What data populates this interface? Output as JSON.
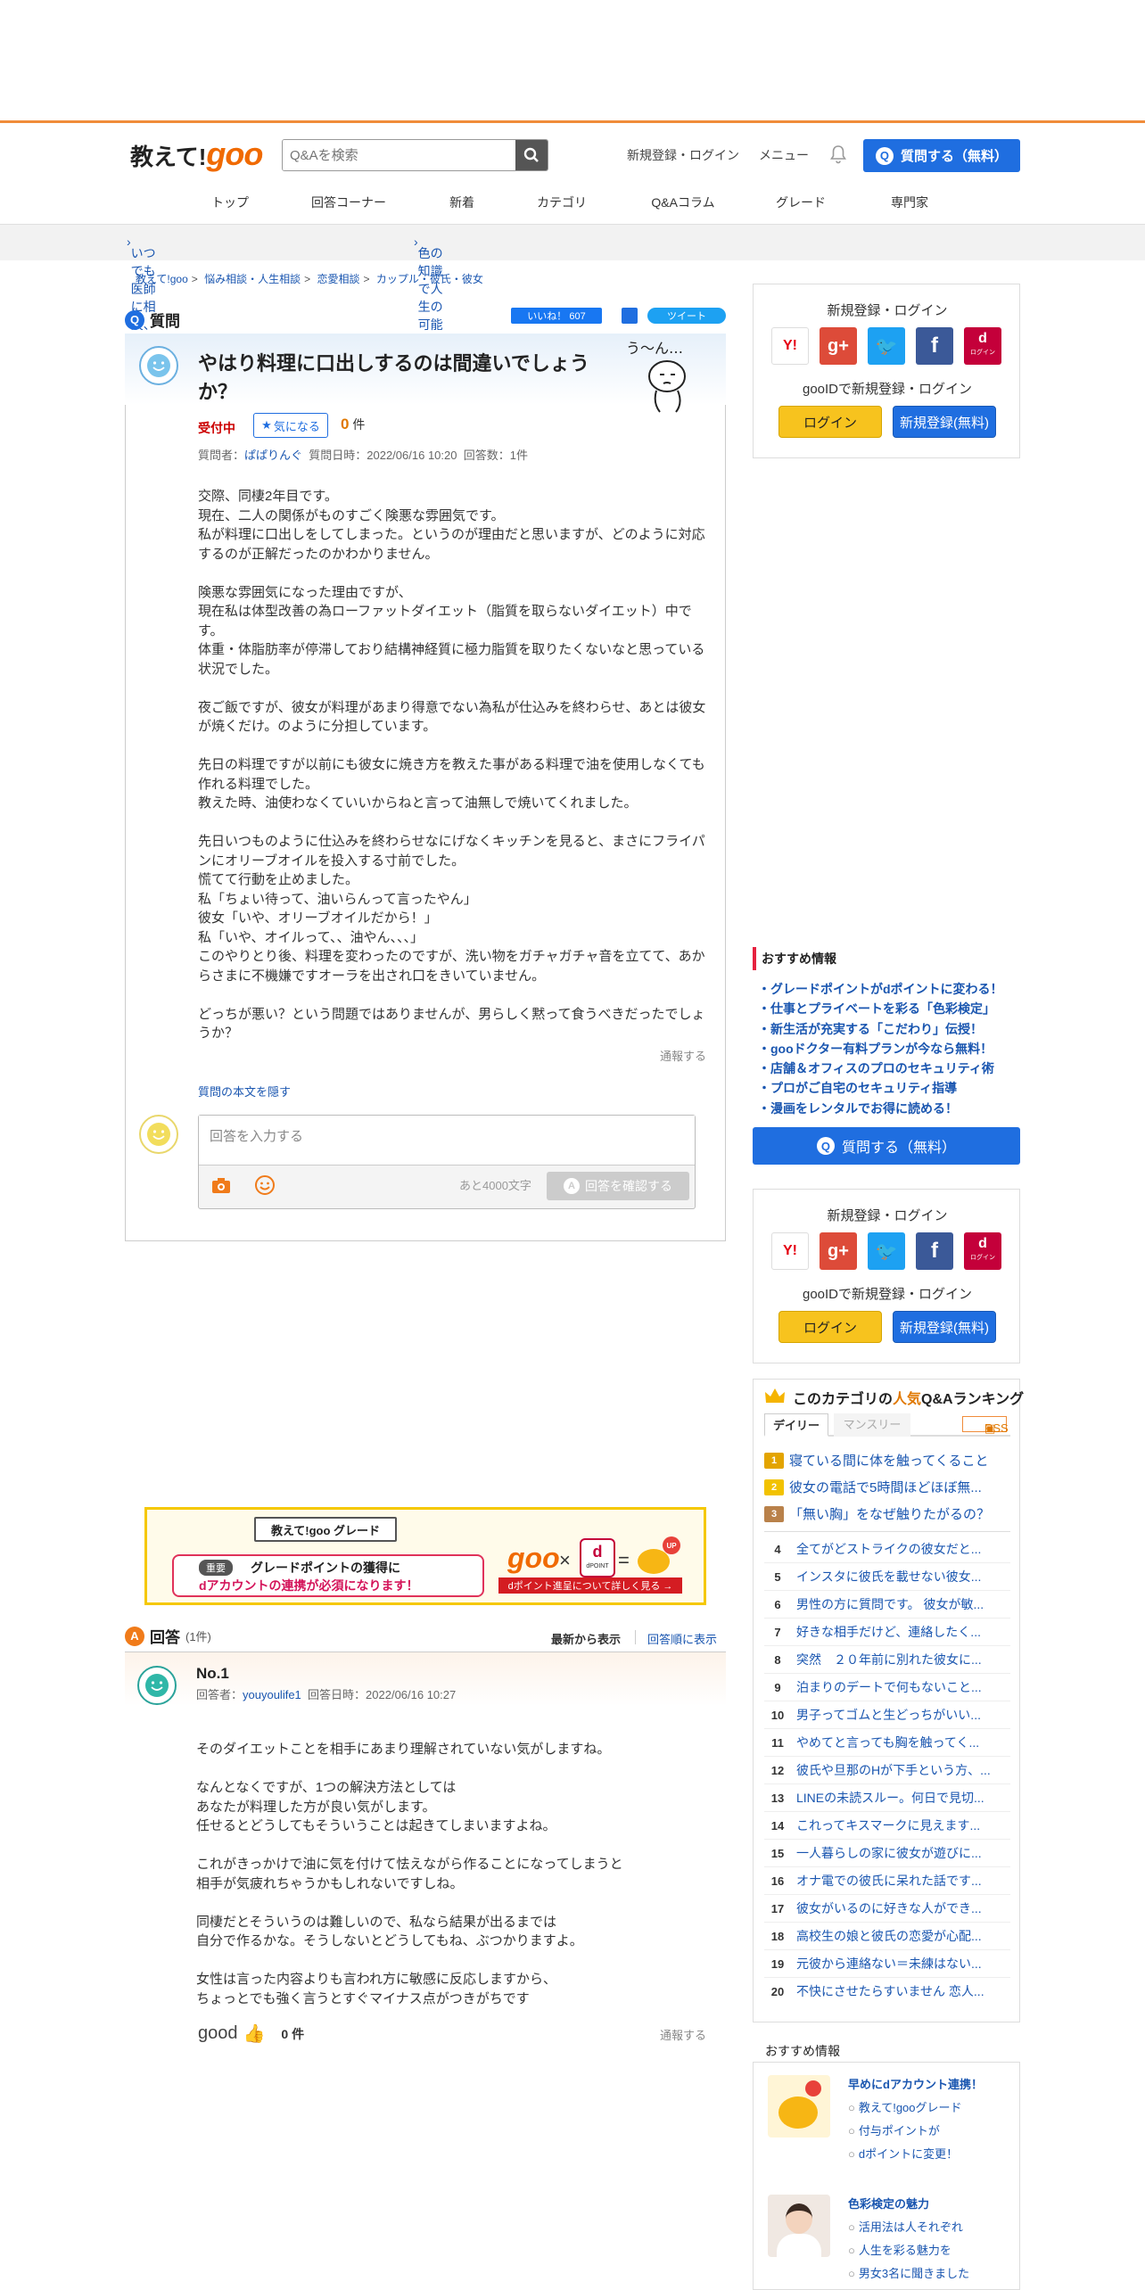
{
  "header": {
    "logo_text": "教えて!",
    "logo_goo": "goo",
    "search_placeholder": "Q&Aを検索",
    "signup_login": "新規登録・ログイン",
    "menu": "メニュー",
    "ask_button": "質問する（無料）"
  },
  "nav": [
    "トップ",
    "回答コーナー",
    "新着",
    "カテゴリ",
    "Q&Aコラム",
    "グレード",
    "専門家"
  ],
  "promo": {
    "left": "いつでも医師に相談、gooドクター",
    "right": "色の知識で人生の可能性が広がる！みんなに役立つ色彩検定 >>"
  },
  "breadcrumb": [
    "教えて!goo",
    "悩み相談・人生相談",
    "恋愛相談",
    "カップル・彼氏・彼女"
  ],
  "question": {
    "section_label": "質問",
    "like_label": "いいね！ 607",
    "tweet_label": "ツイート",
    "title": "やはり料理に口出しするのは間違いでしょうか？",
    "status": "受付中",
    "kininaru": "気になる",
    "kininaru_count": "0",
    "kininaru_unit": "件",
    "meta_asker_label": "質問者：",
    "meta_asker": "ぱぱりんぐ",
    "meta_date": "質問日時：2022/06/16 10:20",
    "meta_answers": "回答数：1件",
    "body": [
      "交際、同棲2年目です。",
      "現在、二人の関係がものすごく険悪な雰囲気です。",
      "私が料理に口出しをしてしまった。というのが理由だと思いますが、どのように対応するのが正解だったのかわかりません。",
      "",
      "険悪な雰囲気になった理由ですが、",
      "現在私は体型改善の為ローファットダイエット（脂質を取らないダイエット）中です。",
      "体重・体脂肪率が停滞しており結構神経質に極力脂質を取りたくないなと思っている状況でした。",
      "",
      "夜ご飯ですが、彼女が料理があまり得意でない為私が仕込みを終わらせ、あとは彼女が焼くだけ。のように分担しています。",
      "",
      "先日の料理ですが以前にも彼女に焼き方を教えた事がある料理で油を使用しなくても作れる料理でした。",
      "教えた時、油使わなくていいからねと言って油無しで焼いてくれました。",
      "",
      "先日いつものように仕込みを終わらせなにげなくキッチンを見ると、まさにフライパンにオリーブオイルを投入する寸前でした。",
      "慌てて行動を止めました。",
      "私「ちょい待って、油いらんって言ったやん」",
      "彼女「いや、オリーブオイルだから！」",
      "私「いや、オイルって、、油やん、、、」",
      "このやりとり後、料理を変わったのですが、洗い物をガチャガチャ音を立てて、あからさまに不機嫌ですオーラを出され口をきいていません。",
      "",
      "どっちが悪い？という問題ではありませんが、男らしく黙って食うべきだったでしょうか？"
    ],
    "report": "通報する",
    "hide_body": "質問の本文を隠す",
    "answer_placeholder": "回答を入力する",
    "char_count": "あと4000文字",
    "confirm_button": "回答を確認する"
  },
  "banner": {
    "title": "教えて!goo グレード",
    "important": "重要",
    "line1": "グレードポイントの獲得に",
    "line2": "dアカウントの連携が必須になります！",
    "goo": "goo",
    "dpoint": "dPOINT",
    "up": "UP",
    "cta": "dポイント進呈について詳しく見る →"
  },
  "answers": {
    "label": "回答",
    "count": "(1件)",
    "sort_new": "最新から表示",
    "sort_old": "回答順に表示",
    "items": [
      {
        "no": "No.1",
        "answerer_label": "回答者：",
        "answerer": "youyoulife1",
        "date": "回答日時：2022/06/16 10:27",
        "body": [
          "そのダイエットことを相手にあまり理解されていない気がしますね。",
          "",
          "なんとなくですが、1つの解決方法としては",
          "あなたが料理した方が良い気がします。",
          "任せるとどうしてもそういうことは起きてしまいますよね。",
          "",
          "これがきっかけで油に気を付けて怯えながら作ることになってしまうと",
          "相手が気疲れちゃうかもしれないですしね。",
          "",
          "同棲だとそういうのは難しいので、私なら結果が出るまでは",
          "自分で作るかな。そうしないとどうしてもね、ぶつかりますよ。",
          "",
          "女性は言った内容よりも言われ方に敏感に反応しますから、",
          "ちょっとでも強く言うとすぐマイナス点がつきがちです"
        ],
        "good_label": "good",
        "good_count": "0",
        "good_unit": "件",
        "report": "通報する"
      }
    ]
  },
  "sidebar": {
    "login_box": {
      "title": "新規登録・ログイン",
      "sub": "gooIDで新規登録・ログイン",
      "login": "ログイン",
      "register": "新規登録(無料)",
      "docomo_label": "ログイン"
    },
    "recommend": {
      "title": "おすすめ情報",
      "items": [
        "グレードポイントがdポイントに変わる！",
        "仕事とプライベートを彩る「色彩検定」",
        "新生活が充実する「こだわり」伝授！",
        "gooドクター有料プランが今なら無料！",
        "店舗＆オフィスのプロのセキュリティ術",
        "プロがご自宅のセキュリティ指導",
        "漫画をレンタルでお得に読める！"
      ]
    },
    "ask_button": "質問する（無料）",
    "ranking": {
      "title_pre": "このカテゴリの",
      "title_hot": "人気",
      "title_post": "Q&Aランキング",
      "tab_daily": "デイリー",
      "tab_monthly": "マンスリー",
      "rss": "RSS",
      "top": [
        "寝ている間に体を触ってくること",
        "彼女の電話で5時間ほどほぼ無...",
        "「無い胸」をなぜ触りたがるの？"
      ],
      "items": [
        "全てがどストライクの彼女だと...",
        "インスタに彼氏を載せない彼女...",
        "男性の方に質問です。 彼女が敏...",
        "好きな相手だけど、連絡したく...",
        "突然　２０年前に別れた彼女に...",
        "泊まりのデートで何もないこと...",
        "男子ってゴムと生どっちがいい...",
        "やめてと言っても胸を触ってく...",
        "彼氏や旦那のHが下手という方、...",
        "LINEの未読スルー。何日で見切...",
        "これってキスマークに見えます...",
        "一人暮らしの家に彼女が遊びに...",
        "オナ電での彼氏に呆れた話です...",
        "彼女がいるのに好きな人ができ...",
        "高校生の娘と彼氏の恋愛が心配...",
        "元彼から連絡ない＝未練はない...",
        "不快にさせたらすいません 恋人..."
      ]
    },
    "recommend2": {
      "title": "おすすめ情報",
      "blocks": [
        {
          "heading": "早めにdアカウント連携！",
          "lines": [
            "教えて!gooグレード",
            "付与ポイントが",
            "dポイントに変更！"
          ]
        },
        {
          "heading": "色彩検定の魅力",
          "lines": [
            "活用法は人それぞれ",
            "人生を彩る魅力を",
            "男女3名に聞きました"
          ]
        }
      ]
    }
  },
  "colors": {
    "brand_orange": "#f06a00",
    "primary_blue": "#1f6ee0",
    "link_blue": "#1a56b0",
    "login_yellow": "#f7c31e",
    "status_red": "#cc0000"
  }
}
